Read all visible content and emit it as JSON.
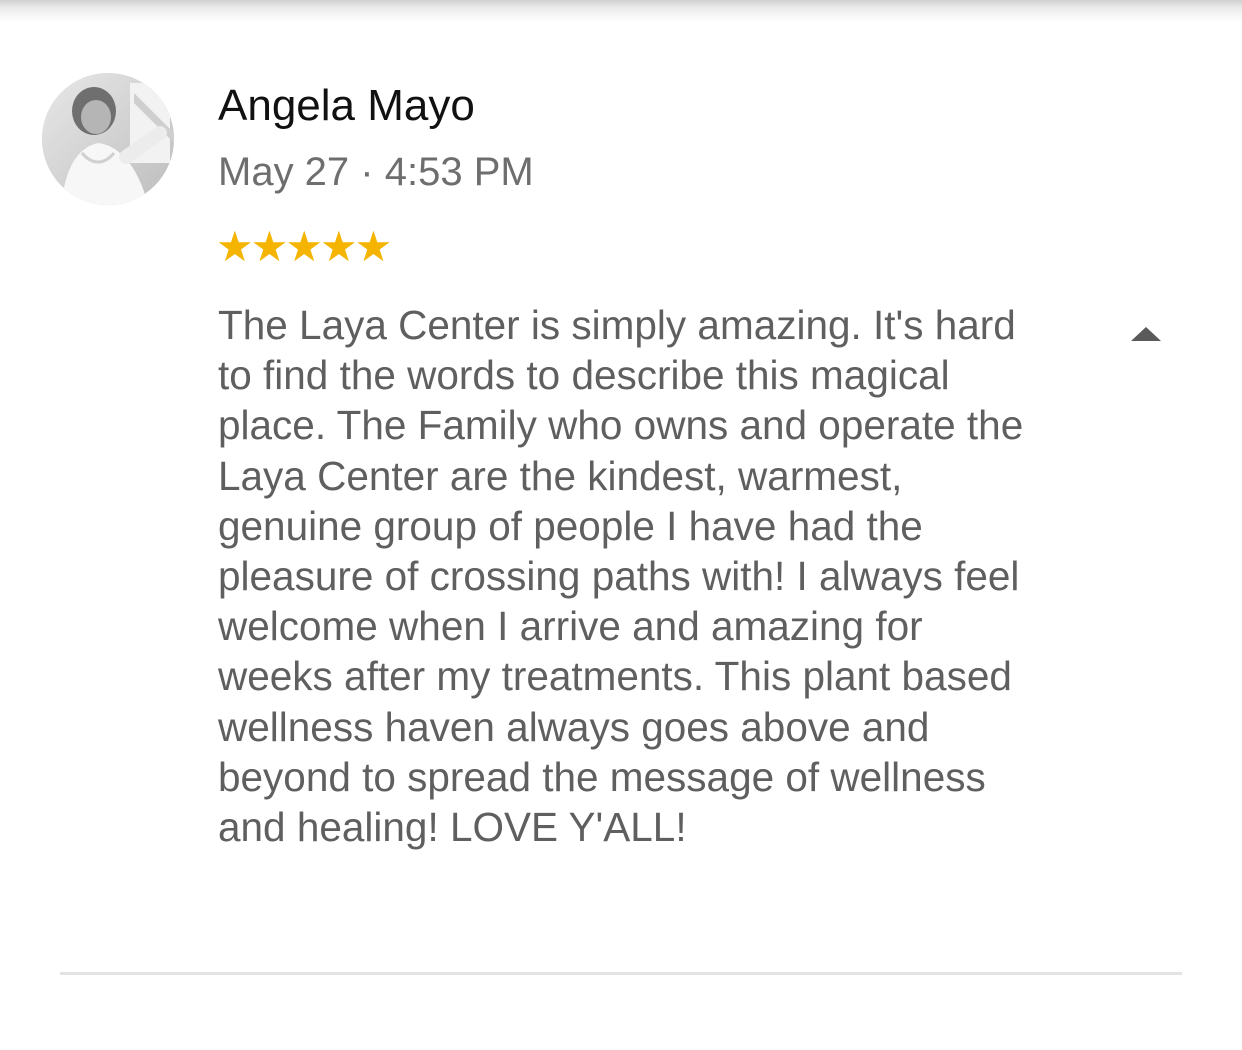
{
  "review": {
    "author": "Angela Mayo",
    "date": "May 27",
    "separator": "·",
    "time": "4:53 PM",
    "rating": 5,
    "rating_max": 5,
    "star_color": "#f4b400",
    "text": "The Laya Center is simply amazing. It's hard to find the words to describe this magical place. The Family who owns and operate the Laya Center are the kindest, warmest, genuine group of people I have had the pleasure of crossing paths with! I always feel welcome when I arrive and amazing for weeks after my treatments. This plant based wellness haven always goes above and beyond to spread the message of wellness and healing! LOVE Y'ALL!",
    "expanded": true,
    "toggle_icon": "caret-up-icon",
    "avatar_icon": "user-photo-avatar"
  }
}
